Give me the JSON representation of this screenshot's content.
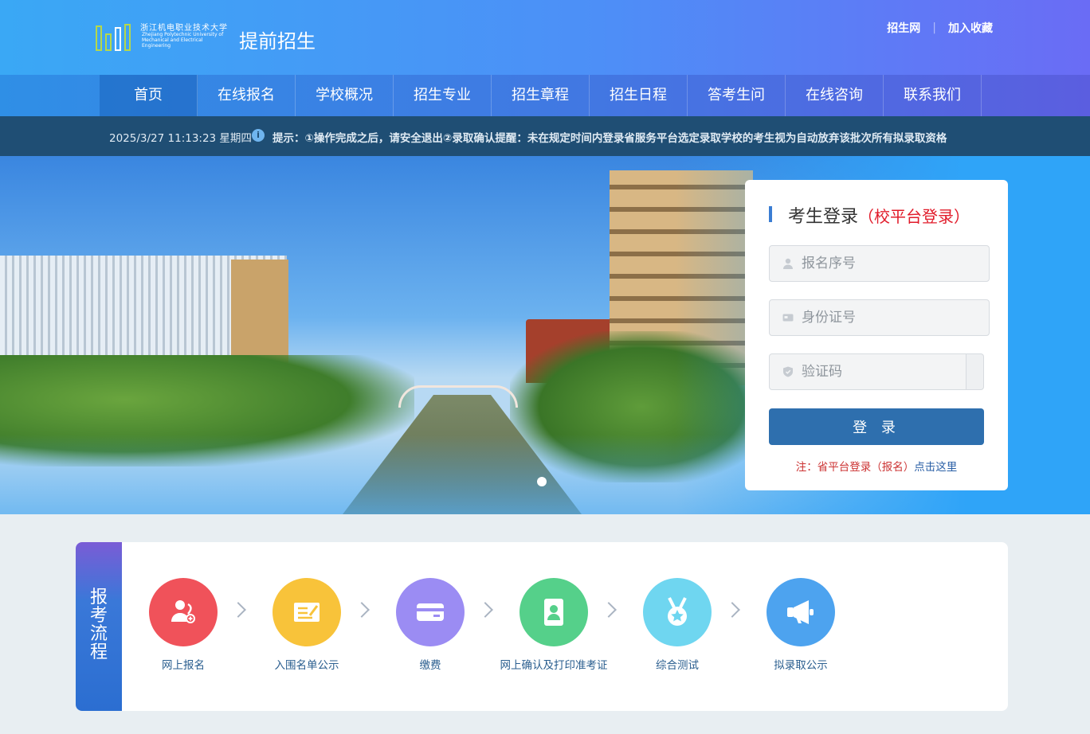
{
  "header": {
    "logo_cn": "浙江机电职业技术大学",
    "logo_en": "Zhejiang Polytechnic University of Mechanical and Electrical Engineering",
    "site_title": "提前招生",
    "links": [
      "招生网",
      "加入收藏"
    ]
  },
  "nav": {
    "items": [
      "首页",
      "在线报名",
      "学校概况",
      "招生专业",
      "招生章程",
      "招生日程",
      "答考生问",
      "在线咨询",
      "联系我们"
    ],
    "active": "首页"
  },
  "notice": {
    "datetime": "2025/3/27 11:13:23 星期四",
    "message": "提示：①操作完成之后，请安全退出②录取确认提醒：未在规定时间内登录省服务平台选定录取学校的考生视为自动放弃该批次所有拟录取资格"
  },
  "login": {
    "title": "考生登录",
    "subtitle": "（校平台登录）",
    "fields": {
      "reg_no_placeholder": "报名序号",
      "id_placeholder": "身份证号",
      "captcha_placeholder": "验证码"
    },
    "button": "登 录",
    "note_prefix": "注：省平台登录（报名）",
    "note_link": "点击这里"
  },
  "process": {
    "side_title": "报考流程",
    "steps": [
      {
        "label": "网上报名",
        "icon": "user-register-icon",
        "color": "#f0525a"
      },
      {
        "label": "入围名单公示",
        "icon": "edit-list-icon",
        "color": "#f8c33a"
      },
      {
        "label": "缴费",
        "icon": "card-payment-icon",
        "color": "#9b8cf3"
      },
      {
        "label": "网上确认及打印准考证",
        "icon": "id-card-icon",
        "color": "#55d08a"
      },
      {
        "label": "综合测试",
        "icon": "medal-icon",
        "color": "#6fd6f0"
      },
      {
        "label": "拟录取公示",
        "icon": "megaphone-icon",
        "color": "#4da3ef"
      }
    ]
  },
  "colors": {
    "header_start": "#3aa8f5",
    "header_end": "#6a6cf5",
    "notice_bg": "#1f4e74",
    "login_button": "#2e6fae",
    "accent_red": "#e11b2a"
  }
}
